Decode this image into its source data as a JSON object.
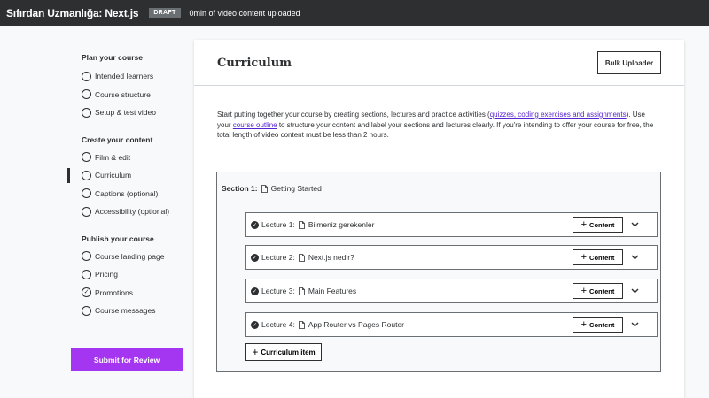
{
  "topbar": {
    "course_title": "Sıfırdan Uzmanlığa: Next.js",
    "badge": "DRAFT",
    "status": "0min of video content uploaded"
  },
  "sidebar": {
    "sections": [
      {
        "title": "Plan your course",
        "items": [
          {
            "label": "Intended learners",
            "checked": false,
            "active": false
          },
          {
            "label": "Course structure",
            "checked": false,
            "active": false
          },
          {
            "label": "Setup & test video",
            "checked": false,
            "active": false
          }
        ]
      },
      {
        "title": "Create your content",
        "items": [
          {
            "label": "Film & edit",
            "checked": false,
            "active": false
          },
          {
            "label": "Curriculum",
            "checked": false,
            "active": true
          },
          {
            "label": "Captions (optional)",
            "checked": false,
            "active": false
          },
          {
            "label": "Accessibility (optional)",
            "checked": false,
            "active": false
          }
        ]
      },
      {
        "title": "Publish your course",
        "items": [
          {
            "label": "Course landing page",
            "checked": false,
            "active": false
          },
          {
            "label": "Pricing",
            "checked": false,
            "active": false
          },
          {
            "label": "Promotions",
            "checked": true,
            "active": false
          },
          {
            "label": "Course messages",
            "checked": false,
            "active": false
          }
        ]
      }
    ],
    "submit_label": "Submit for Review"
  },
  "main": {
    "title": "Curriculum",
    "bulk_uploader_label": "Bulk Uploader",
    "intro": {
      "part1": "Start putting together your course by creating sections, lectures and practice activities (",
      "link1": "quizzes, coding exercises and assignments",
      "part2": "). Use your ",
      "link2": "course outline",
      "part3": " to structure your content and label your sections and lectures clearly. If you're intending to offer your course for free, the total length of video content must be less than 2 hours."
    },
    "section": {
      "label": "Section 1:",
      "title": "Getting Started"
    },
    "lectures": [
      {
        "number": "Lecture 1:",
        "title": "Bilmeniz gerekenler",
        "content_label": "Content"
      },
      {
        "number": "Lecture 2:",
        "title": "Next.js nedir?",
        "content_label": "Content"
      },
      {
        "number": "Lecture 3:",
        "title": "Main Features",
        "content_label": "Content"
      },
      {
        "number": "Lecture 4:",
        "title": "App Router vs Pages Router",
        "content_label": "Content"
      }
    ],
    "curriculum_item_label": "Curriculum item"
  },
  "colors": {
    "topbar_bg": "#2d2f31",
    "accent_purple": "#a435f0",
    "link_purple": "#5624d0"
  }
}
